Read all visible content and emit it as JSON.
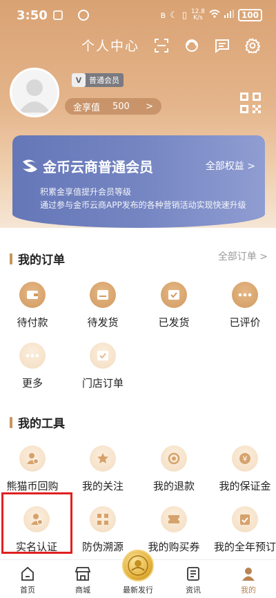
{
  "status": {
    "time": "3:50",
    "net_top": "12.8",
    "net_bottom": "K/s",
    "battery": "100"
  },
  "header": {
    "title": "个人中心"
  },
  "profile": {
    "member_badge": "普通会员",
    "badge_logo": "V",
    "score_label": "金享值",
    "score_value": "500",
    "score_arrow": ">"
  },
  "card": {
    "title": "金币云商普通会员",
    "link": "全部权益 >",
    "line1": "积累金享值提升会员等级",
    "line2": "通过参与金币云商APP发布的各种营销活动实现快速升级"
  },
  "orders": {
    "title": "我的订单",
    "link": "全部订单 >",
    "items": [
      {
        "label": "待付款",
        "icon": "wallet-icon"
      },
      {
        "label": "待发货",
        "icon": "box-icon"
      },
      {
        "label": "已发货",
        "icon": "shipped-icon"
      },
      {
        "label": "已评价",
        "icon": "comment-icon"
      },
      {
        "label": "更多",
        "icon": "more-icon"
      },
      {
        "label": "门店订单",
        "icon": "store-order-icon"
      }
    ]
  },
  "tools": {
    "title": "我的工具",
    "items": [
      {
        "label": "熊猫币回购",
        "icon": "buyback-icon"
      },
      {
        "label": "我的关注",
        "icon": "star-icon"
      },
      {
        "label": "我的退款",
        "icon": "refund-icon"
      },
      {
        "label": "我的保证金",
        "icon": "deposit-icon"
      },
      {
        "label": "实名认证",
        "icon": "verify-icon"
      },
      {
        "label": "防伪溯源",
        "icon": "trace-icon"
      },
      {
        "label": "我的购买券",
        "icon": "coupon-icon"
      },
      {
        "label": "我的全年预订",
        "icon": "preorder-icon"
      }
    ]
  },
  "bottom_nav": [
    {
      "label": "首页",
      "icon": "home-icon"
    },
    {
      "label": "商城",
      "icon": "shop-icon"
    },
    {
      "label": "最新发行",
      "icon": "coin-icon"
    },
    {
      "label": "资讯",
      "icon": "news-icon"
    },
    {
      "label": "我的",
      "icon": "profile-icon"
    }
  ],
  "colors": {
    "accent": "#c9955d",
    "card": "#6f80bf",
    "highlight": "#e02020"
  }
}
